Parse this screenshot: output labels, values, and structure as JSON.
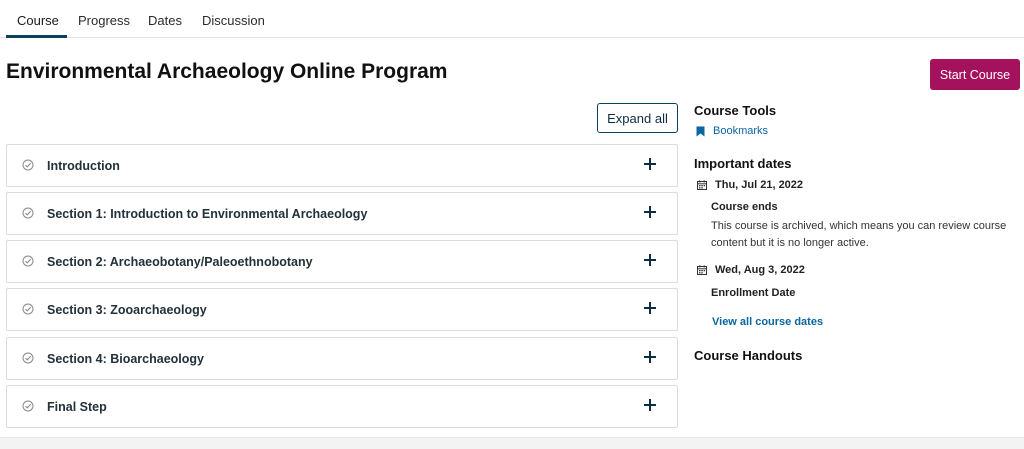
{
  "tabs": [
    {
      "label": "Course"
    },
    {
      "label": "Progress"
    },
    {
      "label": "Dates"
    },
    {
      "label": "Discussion"
    }
  ],
  "page_title": "Environmental Archaeology Online Program",
  "start_button": "Start Course",
  "expand_button": "Expand all",
  "sections": [
    {
      "label": "Introduction"
    },
    {
      "label": "Section 1: Introduction to Environmental Archaeology"
    },
    {
      "label": "Section 2: Archaeobotany/Paleoethnobotany"
    },
    {
      "label": "Section 3: Zooarchaeology"
    },
    {
      "label": "Section 4: Bioarchaeology"
    },
    {
      "label": "Final Step"
    }
  ],
  "sidebar": {
    "course_tools_heading": "Course Tools",
    "bookmarks_label": "Bookmarks",
    "important_dates_heading": "Important dates",
    "dates": [
      {
        "date": "Thu, Jul 21, 2022",
        "title": "Course ends",
        "description": "This course is archived, which means you can review course content but it is no longer active."
      },
      {
        "date": "Wed, Aug 3, 2022",
        "title": "Enrollment Date"
      }
    ],
    "view_all_link": "View all course dates",
    "handouts_heading": "Course Handouts"
  },
  "colors": {
    "accent": "#a4125d",
    "primary_dark": "#0e3f5c",
    "link": "#0a66a0"
  }
}
